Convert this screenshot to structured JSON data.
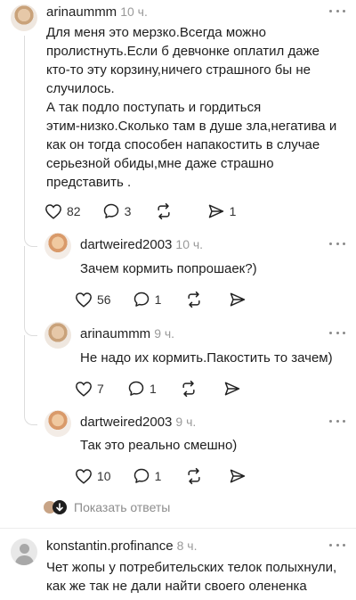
{
  "comments": [
    {
      "author": "arinaummm",
      "time": "10 ч.",
      "lines": [
        "Для меня это мерзко.Всегда можно",
        "пролистнуть.Если б девчонке оплатил даже",
        "кто-то эту корзину,ничего страшного бы не",
        "случилось.",
        "А так подло поступать и гордиться",
        "этим-низко.Сколько там в душе зла,негатива и",
        "как он тогда способен напакостить в случае",
        "серьезной обиды,мне даже страшно",
        "представить ."
      ],
      "likes": "82",
      "replies": "3",
      "reposts": "",
      "shares": "1"
    },
    {
      "author": "dartweired2003",
      "time": "10 ч.",
      "lines": [
        "Зачем кормить попрошаек?)"
      ],
      "likes": "56",
      "replies": "1",
      "reposts": "",
      "shares": ""
    },
    {
      "author": "arinaummm",
      "time": "9 ч.",
      "lines": [
        "Не надо их кормить.Пакостить то зачем)"
      ],
      "likes": "7",
      "replies": "1",
      "reposts": "",
      "shares": ""
    },
    {
      "author": "dartweired2003",
      "time": "9 ч.",
      "lines": [
        "Так это реально смешно)"
      ],
      "likes": "10",
      "replies": "1",
      "reposts": "",
      "shares": ""
    },
    {
      "author": "konstantin.profinance",
      "time": "8 ч.",
      "lines": [
        "Чет жопы у потребительских телок полыхнули,",
        "как же так не дали найти своего олененка"
      ]
    }
  ],
  "show_replies_label": "Показать ответы",
  "icons": {
    "like": "heart-icon",
    "reply": "speech-bubble-icon",
    "repost": "repost-arrows-icon",
    "share": "send-icon",
    "more": "more-dots-icon",
    "expand": "arrow-down-icon"
  }
}
